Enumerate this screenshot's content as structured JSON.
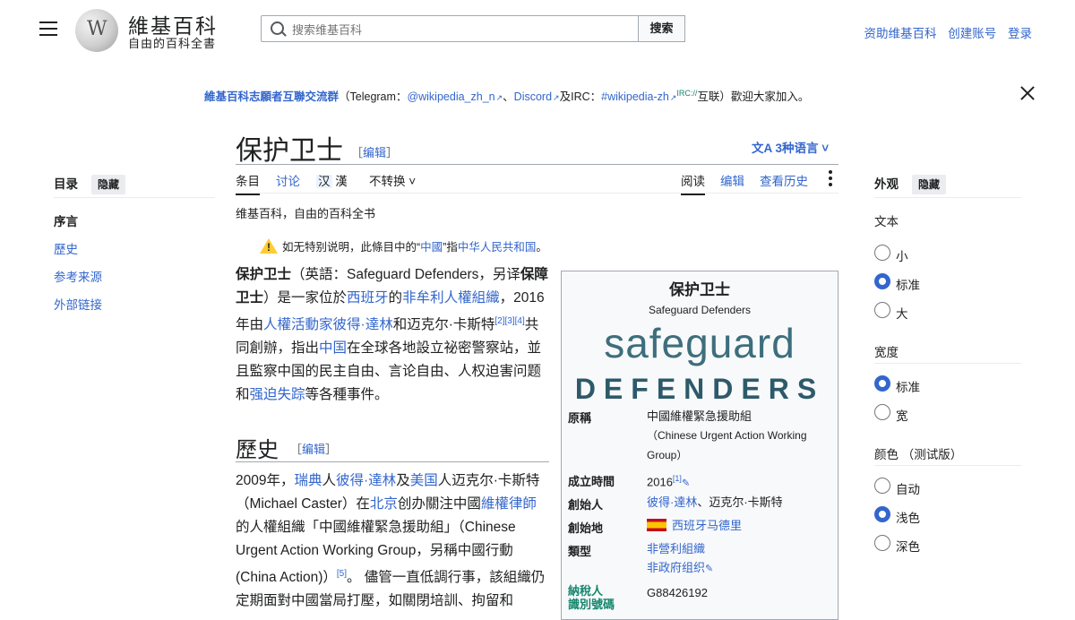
{
  "header": {
    "logo_title": "維基百科",
    "logo_subtitle": "自由的百科全書",
    "search_placeholder": "搜索维基百科",
    "search_button": "搜索",
    "links": [
      "资助维基百科",
      "创建账号",
      "登录"
    ]
  },
  "banner": {
    "lead": "維基百科志願者互聯交流群",
    "t1": "（Telegram：",
    "telegram": "@wikipedia_zh_n",
    "t2": "、",
    "discord": "Discord",
    "t3": "及IRC：",
    "irc": "#wikipedia-zh",
    "irc_sup": "IRC://",
    "t4": "互联）歡迎大家加入。"
  },
  "article": {
    "title": "保护卫士",
    "edit_open": "［",
    "edit_label": "编辑",
    "edit_close": "］",
    "languages": "3种语言",
    "tabs": {
      "article": "条目",
      "talk": "讨论",
      "han": "汉",
      "han2": "漢",
      "variant": "不转换",
      "read": "阅读",
      "edit": "编辑",
      "history": "查看历史"
    },
    "tagline": "维基百科，自由的百科全书",
    "hatnote": {
      "pre": "如无特别说明，此條目中的“",
      "link1": "中國",
      "mid": "”指",
      "link2": "中华人民共和国",
      "post": "。"
    }
  },
  "toc": {
    "heading": "目录",
    "hide": "隐藏",
    "items": [
      "序言",
      "歷史",
      "参考来源",
      "外部链接"
    ]
  },
  "intro": {
    "b1": "保护卫士",
    "s1": "（英語：Safeguard Defenders，另译",
    "b2": "保障卫士",
    "s2": "）是一家位於",
    "l1": "西班牙",
    "s3": "的",
    "l2": "非牟利人權組織",
    "s4": "，2016年由",
    "l3": "人權活動家",
    "l4": "彼得·達林",
    "s5": "和迈克尔·卡斯特",
    "r1": "[2]",
    "r2": "[3]",
    "r3": "[4]",
    "s6": "共同創辦，指出",
    "l5": "中国",
    "s7": "在全球各地設立祕密警察站，並且監察中国的民主自由、言论自由、人权迫害问题和",
    "l6": "强迫失踪",
    "s8": "等各種事件。"
  },
  "history": {
    "heading": "歷史",
    "s1": "2009年，",
    "l1": "瑞典",
    "s2": "人",
    "l2": "彼得·達林",
    "s3": "及",
    "l3": "美国",
    "s4": "人迈克尔·卡斯特（Michael Caster）在",
    "l4": "北京",
    "s5": "创办關注中國",
    "l5": "維權律師",
    "s6": "的人權組織「中國維權緊急援助組」（Chinese Urgent Action Working Group，另稱中國行動(China Action)）",
    "r1": "[5]",
    "s7": "。 儘管一直低調行事，該組織仍定期面對中國當局打壓，如關閉培訓、拘留和"
  },
  "infobox": {
    "title": "保护卫士",
    "subtitle": "Safeguard Defenders",
    "logo_line1": "safeguard",
    "logo_line2": "DEFENDERS",
    "rows": [
      {
        "k": "原稱",
        "v": "中國維權緊急援助組",
        "v2": "（Chinese Urgent Action Working Group）"
      },
      {
        "k": "成立時間",
        "v": "2016",
        "ref": "[1]"
      },
      {
        "k": "創始人",
        "l1": "彼得·達林",
        "v": "、迈克尔·卡斯特"
      },
      {
        "k": "創始地",
        "l1": "西班牙马德里"
      },
      {
        "k": "類型",
        "l1": "非營利組織",
        "l2": "非政府组织"
      },
      {
        "k": "納稅人",
        "k2": "識別號碼",
        "v": "G88426192"
      }
    ]
  },
  "appearance": {
    "heading": "外观",
    "hide": "隐藏",
    "text_label": "文本",
    "text_opts": [
      "小",
      "标准",
      "大"
    ],
    "width_label": "宽度",
    "width_opts": [
      "标准",
      "宽"
    ],
    "color_label": "颜色",
    "color_note": "（测试版）",
    "color_opts": [
      "自动",
      "浅色",
      "深色"
    ],
    "selected": {
      "text": "标准",
      "width": "标准",
      "color": "浅色"
    },
    "accent": "#3366cc"
  }
}
